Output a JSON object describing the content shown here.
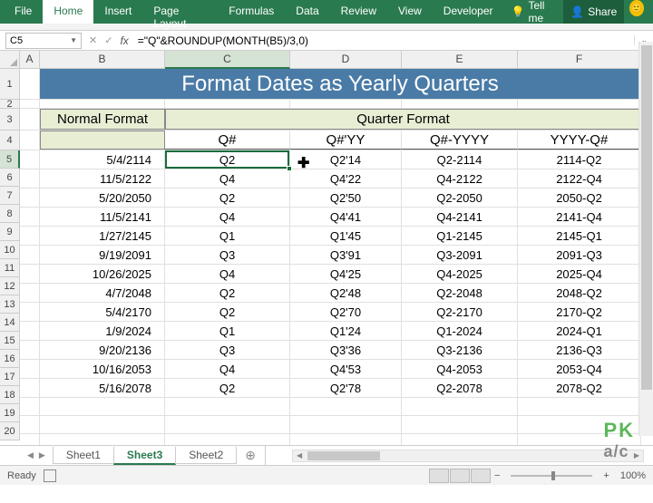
{
  "ribbon": {
    "tabs": [
      "File",
      "Home",
      "Insert",
      "Page Layout",
      "Formulas",
      "Data",
      "Review",
      "View",
      "Developer"
    ],
    "tell_me": "Tell me",
    "share": "Share"
  },
  "name_box": "C5",
  "formula": "=\"Q\"&ROUNDUP(MONTH(B5)/3,0)",
  "columns": [
    "A",
    "B",
    "C",
    "D",
    "E",
    "F"
  ],
  "title": "Format Dates as Yearly Quarters",
  "header_b": "Normal Format",
  "header_merged": "Quarter Format",
  "subheaders": {
    "c": "Q#",
    "d": "Q#'YY",
    "e": "Q#-YYYY",
    "f": "YYYY-Q#"
  },
  "rows": [
    {
      "n": "5",
      "b": "5/4/2114",
      "c": "Q2",
      "d": "Q2'14",
      "e": "Q2-2114",
      "f": "2114-Q2"
    },
    {
      "n": "6",
      "b": "11/5/2122",
      "c": "Q4",
      "d": "Q4'22",
      "e": "Q4-2122",
      "f": "2122-Q4"
    },
    {
      "n": "7",
      "b": "5/20/2050",
      "c": "Q2",
      "d": "Q2'50",
      "e": "Q2-2050",
      "f": "2050-Q2"
    },
    {
      "n": "8",
      "b": "11/5/2141",
      "c": "Q4",
      "d": "Q4'41",
      "e": "Q4-2141",
      "f": "2141-Q4"
    },
    {
      "n": "9",
      "b": "1/27/2145",
      "c": "Q1",
      "d": "Q1'45",
      "e": "Q1-2145",
      "f": "2145-Q1"
    },
    {
      "n": "10",
      "b": "9/19/2091",
      "c": "Q3",
      "d": "Q3'91",
      "e": "Q3-2091",
      "f": "2091-Q3"
    },
    {
      "n": "11",
      "b": "10/26/2025",
      "c": "Q4",
      "d": "Q4'25",
      "e": "Q4-2025",
      "f": "2025-Q4"
    },
    {
      "n": "12",
      "b": "4/7/2048",
      "c": "Q2",
      "d": "Q2'48",
      "e": "Q2-2048",
      "f": "2048-Q2"
    },
    {
      "n": "13",
      "b": "5/4/2170",
      "c": "Q2",
      "d": "Q2'70",
      "e": "Q2-2170",
      "f": "2170-Q2"
    },
    {
      "n": "14",
      "b": "1/9/2024",
      "c": "Q1",
      "d": "Q1'24",
      "e": "Q1-2024",
      "f": "2024-Q1"
    },
    {
      "n": "15",
      "b": "9/20/2136",
      "c": "Q3",
      "d": "Q3'36",
      "e": "Q3-2136",
      "f": "2136-Q3"
    },
    {
      "n": "16",
      "b": "10/16/2053",
      "c": "Q4",
      "d": "Q4'53",
      "e": "Q4-2053",
      "f": "2053-Q4"
    },
    {
      "n": "17",
      "b": "5/16/2078",
      "c": "Q2",
      "d": "Q2'78",
      "e": "Q2-2078",
      "f": "2078-Q2"
    }
  ],
  "empty_rows": [
    "18",
    "19",
    "20"
  ],
  "sheets": [
    "Sheet1",
    "Sheet3",
    "Sheet2"
  ],
  "active_sheet": "Sheet3",
  "status": {
    "ready": "Ready",
    "zoom": "100%"
  },
  "watermark": {
    "top": "PK",
    "bot": "a/c"
  }
}
